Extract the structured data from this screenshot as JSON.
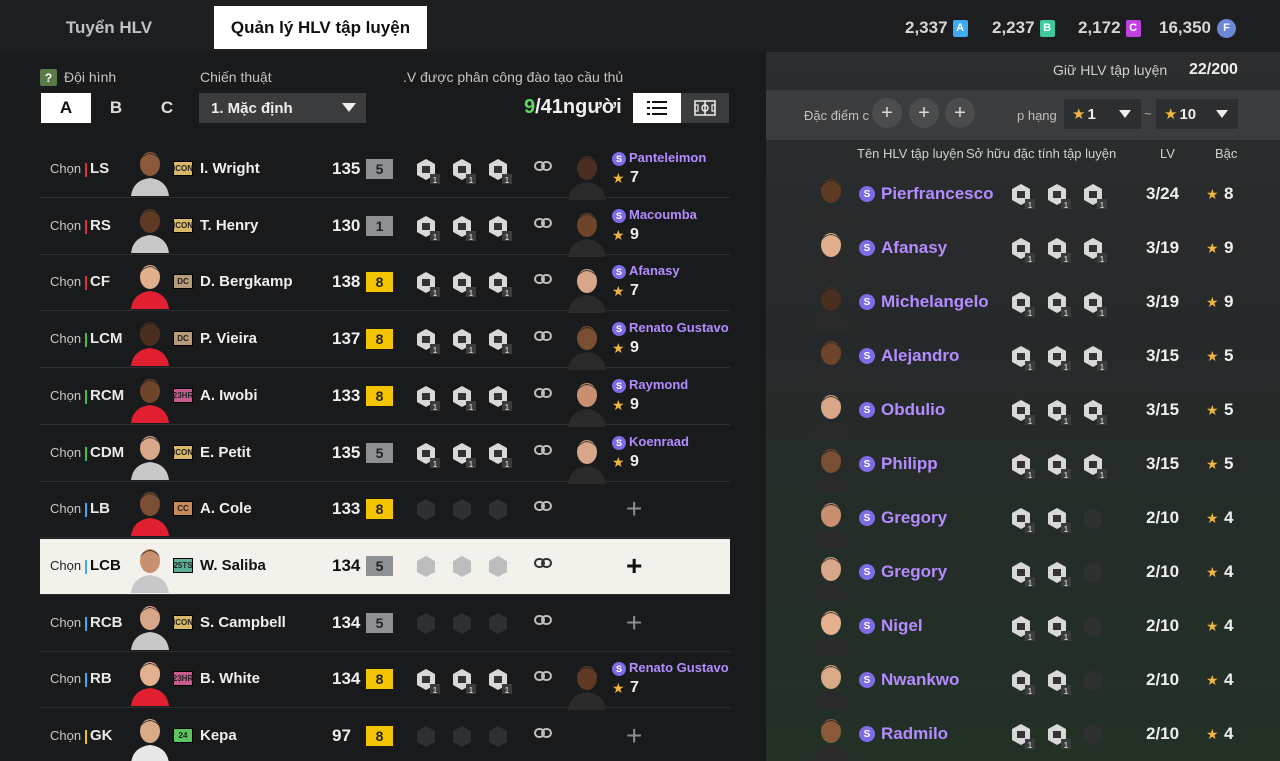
{
  "tabs": {
    "recruit": "Tuyển HLV",
    "manage": "Quản lý HLV tập luyện"
  },
  "currencies": [
    {
      "value": "2,337",
      "badge": "A",
      "color": "#3fa9f5"
    },
    {
      "value": "2,237",
      "badge": "B",
      "color": "#3ec9a0"
    },
    {
      "value": "2,172",
      "badge": "C",
      "color": "#c040e0"
    },
    {
      "value": "16,350",
      "badge": "coin-icon",
      "color": "#6d86d6"
    }
  ],
  "left": {
    "help_icon": "?",
    "formation_label": "Đội hình",
    "formations": [
      "A",
      "B",
      "C"
    ],
    "tactic_label": "Chiến thuật",
    "tactic_value": "1. Mặc định",
    "assigned_label": ".V được phân công đào tạo cầu thủ",
    "assigned_current": "9",
    "assigned_total": "/41người",
    "choose_label": "Chọn"
  },
  "players": [
    {
      "pos": "LS",
      "pos_color": "#e0303a",
      "season": "ICON",
      "season_color": "#d9b86a",
      "name": "I. Wright",
      "ovr": "135",
      "level": "5",
      "level_style": "gray",
      "coach": {
        "name": "Panteleimon",
        "grade": "7"
      }
    },
    {
      "pos": "RS",
      "pos_color": "#e0303a",
      "season": "ICON",
      "season_color": "#d9b86a",
      "name": "T. Henry",
      "ovr": "130",
      "level": "1",
      "level_style": "gray",
      "coach": {
        "name": "Macoumba",
        "grade": "9"
      }
    },
    {
      "pos": "CF",
      "pos_color": "#e0303a",
      "season": "DC",
      "season_color": "#b89c7a",
      "name": "D. Bergkamp",
      "ovr": "138",
      "level": "8",
      "level_style": "gold",
      "coach": {
        "name": "Afanasy",
        "grade": "7"
      }
    },
    {
      "pos": "LCM",
      "pos_color": "#3ec24a",
      "season": "DC",
      "season_color": "#b89c7a",
      "name": "P. Vieira",
      "ovr": "137",
      "level": "8",
      "level_style": "gold",
      "coach": {
        "name": "Renato Gustavo",
        "grade": "9"
      }
    },
    {
      "pos": "RCM",
      "pos_color": "#3ec24a",
      "season": "23HR",
      "season_color": "#c95a8e",
      "name": "A. Iwobi",
      "ovr": "133",
      "level": "8",
      "level_style": "gold",
      "coach": {
        "name": "Raymond",
        "grade": "9"
      }
    },
    {
      "pos": "CDM",
      "pos_color": "#3ec24a",
      "season": "ICON",
      "season_color": "#d9b86a",
      "name": "E. Petit",
      "ovr": "135",
      "level": "5",
      "level_style": "gray",
      "coach": {
        "name": "Koenraad",
        "grade": "9"
      }
    },
    {
      "pos": "LB",
      "pos_color": "#3fa9f5",
      "season": "CC",
      "season_color": "#c98a5a",
      "name": "A. Cole",
      "ovr": "133",
      "level": "8",
      "level_style": "gold",
      "coach": null
    },
    {
      "pos": "LCB",
      "pos_color": "#3fa9f5",
      "season": "25TS",
      "season_color": "#5ab09a",
      "name": "W. Saliba",
      "ovr": "134",
      "level": "5",
      "level_style": "gray",
      "coach": null
    },
    {
      "pos": "RCB",
      "pos_color": "#3fa9f5",
      "season": "ICON",
      "season_color": "#d9b86a",
      "name": "S. Campbell",
      "ovr": "134",
      "level": "5",
      "level_style": "gray",
      "coach": null
    },
    {
      "pos": "RB",
      "pos_color": "#3fa9f5",
      "season": "23HR",
      "season_color": "#c95a8e",
      "name": "B. White",
      "ovr": "134",
      "level": "8",
      "level_style": "gold",
      "coach": {
        "name": "Renato Gustavo",
        "grade": "7"
      }
    },
    {
      "pos": "GK",
      "pos_color": "#f5c400",
      "season": "24",
      "season_color": "#5cc45c",
      "name": "Kepa",
      "ovr": "97",
      "level": "8",
      "level_style": "gold",
      "coach": null
    }
  ],
  "right": {
    "keep_label": "Giữ HLV tập luyện",
    "keep_count": "22/200",
    "trait_filter_label": "Đặc điểm c",
    "rank_label": "p hạng",
    "rank_from": "1",
    "rank_to": "10",
    "tilde": "~",
    "col_name": "Tên HLV tập luyện",
    "col_traits": "Sở hữu đặc tính tập luyện",
    "col_lv": "LV",
    "col_grade": "Bậc"
  },
  "coaches": [
    {
      "name": "Pierfrancesco",
      "lv": "3/24",
      "grade": "8",
      "traits": 3
    },
    {
      "name": "Afanasy",
      "lv": "3/19",
      "grade": "9",
      "traits": 3
    },
    {
      "name": "Michelangelo",
      "lv": "3/19",
      "grade": "9",
      "traits": 3
    },
    {
      "name": "Alejandro",
      "lv": "3/15",
      "grade": "5",
      "traits": 3
    },
    {
      "name": "Obdulio",
      "lv": "3/15",
      "grade": "5",
      "traits": 3
    },
    {
      "name": "Philipp",
      "lv": "3/15",
      "grade": "5",
      "traits": 3
    },
    {
      "name": "Gregory",
      "lv": "2/10",
      "grade": "4",
      "traits": 2
    },
    {
      "name": "Gregory",
      "lv": "2/10",
      "grade": "4",
      "traits": 2
    },
    {
      "name": "Nigel",
      "lv": "2/10",
      "grade": "4",
      "traits": 2
    },
    {
      "name": "Nwankwo",
      "lv": "2/10",
      "grade": "4",
      "traits": 2
    },
    {
      "name": "Radmilo",
      "lv": "2/10",
      "grade": "4",
      "traits": 2
    }
  ],
  "star_glyph": "★",
  "plus_glyph": "+",
  "trait_level": "1"
}
